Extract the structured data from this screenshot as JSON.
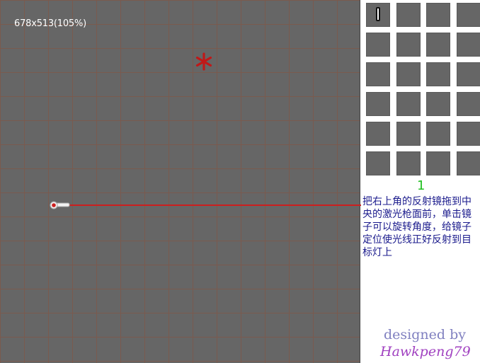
{
  "game": {
    "size_label": "678x513(105%)",
    "mirror_count": "1",
    "instructions": "把右上角的反射镜拖到中央的激光枪面前，单击镜子可以旋转角度，给镜子定位使光线正好反射到目标灯上",
    "credit_line1": "designed by",
    "credit_line2": "Hawkpeng79"
  },
  "colors": {
    "board": "#666666",
    "grid_line": "#7a5a4e",
    "laser": "#cc1f1f",
    "target": "#c01818",
    "counter": "#1fbf1f",
    "instructions": "#1a1a8c"
  },
  "icons": {
    "target": "target-star-icon",
    "laser": "laser-gun-icon",
    "mirror": "mirror-icon"
  }
}
